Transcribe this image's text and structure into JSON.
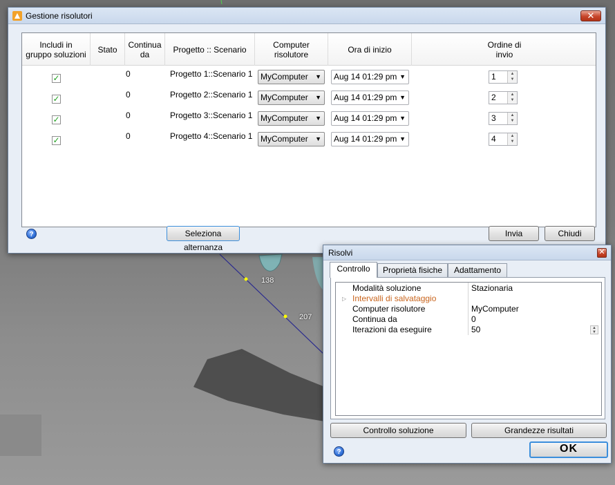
{
  "gestione": {
    "title": "Gestione risolutori",
    "columns": [
      "Includi in\ngruppo soluzioni",
      "Stato",
      "Continua\nda",
      "Progetto :: Scenario",
      "Computer\nrisolutore",
      "Ora di inizio",
      "Ordine di\ninvio"
    ],
    "rows": [
      {
        "checked": true,
        "stato": "",
        "continua": "0",
        "scenario": "Progetto 1::Scenario 1",
        "computer": "MyComputer",
        "ora": "Aug 14 01:29 pm",
        "ordine": "1"
      },
      {
        "checked": true,
        "stato": "",
        "continua": "0",
        "scenario": "Progetto 2::Scenario 1",
        "computer": "MyComputer",
        "ora": "Aug 14 01:29 pm",
        "ordine": "2"
      },
      {
        "checked": true,
        "stato": "",
        "continua": "0",
        "scenario": "Progetto 3::Scenario 1",
        "computer": "MyComputer",
        "ora": "Aug 14 01:29 pm",
        "ordine": "3"
      },
      {
        "checked": true,
        "stato": "",
        "continua": "0",
        "scenario": "Progetto 4::Scenario 1",
        "computer": "MyComputer",
        "ora": "Aug 14 01:29 pm",
        "ordine": "4"
      }
    ],
    "buttons": {
      "alternanza": "Seleziona alternanza",
      "invia": "Invia",
      "chiudi": "Chiudi"
    },
    "help": "?",
    "close": "✕"
  },
  "risolvi": {
    "title": "Risolvi",
    "close": "✕",
    "tabs": [
      "Controllo",
      "Proprietà fisiche",
      "Adattamento"
    ],
    "properties": [
      {
        "name": "Modalità soluzione",
        "value": "Stazionaria"
      },
      {
        "name": "Intervalli di salvataggio",
        "value": "",
        "group": true
      },
      {
        "name": "Computer risolutore",
        "value": "MyComputer"
      },
      {
        "name": "Continua da",
        "value": "0"
      },
      {
        "name": "Iterazioni da eseguire",
        "value": "50"
      }
    ],
    "buttons": {
      "controllo": "Controllo soluzione",
      "grandezze": "Grandezze risultati",
      "ok": "OK"
    },
    "help": "?"
  },
  "viewport": {
    "labels": [
      "138",
      "207"
    ],
    "colors": {
      "line": "#2b2b8f",
      "point": "#ffff00",
      "pipe": "#7fb3b5"
    }
  }
}
